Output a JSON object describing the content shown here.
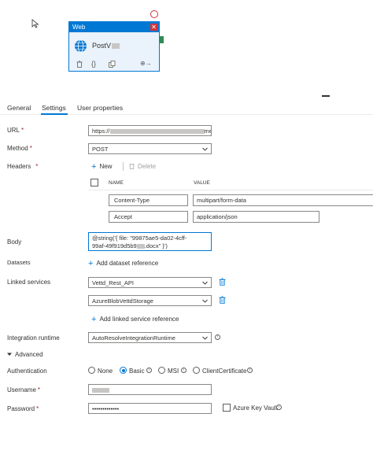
{
  "canvas": {
    "activity": {
      "type_label": "Web",
      "name": "PostV",
      "close_glyph": "✕",
      "tools": [
        "delete-icon",
        "code-icon",
        "copy-icon",
        "arrow-output-icon"
      ],
      "code_glyph": "{}",
      "out_glyph": "⊕→"
    }
  },
  "tabs": [
    {
      "label": "General"
    },
    {
      "label": "Settings",
      "active": true
    },
    {
      "label": "User properties"
    }
  ],
  "form": {
    "url": {
      "label": "URL",
      "value_prefix": "https://",
      "value_suffix": "me"
    },
    "method": {
      "label": "Method",
      "value": "POST"
    },
    "headers": {
      "label": "Headers",
      "new_label": "New",
      "delete_label": "Delete",
      "col_name": "NAME",
      "col_value": "VALUE",
      "rows": [
        {
          "name": "Content-Type",
          "value": "multipart/form-data"
        },
        {
          "name": "Accept",
          "value": "application/json"
        }
      ]
    },
    "body": {
      "label": "Body",
      "line1": "@string('{ file: \"99875ae5-da02-4cff-",
      "line2_a": "99af-49f919d5b9",
      "line2_b": ".docx\" }')"
    },
    "datasets": {
      "label": "Datasets",
      "add_label": "Add dataset reference"
    },
    "linked_services": {
      "label": "Linked services",
      "items": [
        "Vettd_Rest_API",
        "AzureBlobVettdStorage"
      ],
      "add_label": "Add linked service reference"
    },
    "integration_runtime": {
      "label": "Integration runtime",
      "value": "AutoResolveIntegrationRuntime"
    },
    "advanced": {
      "label": "Advanced"
    },
    "authentication": {
      "label": "Authentication",
      "options": [
        "None",
        "Basic",
        "MSI",
        "ClientCertificate"
      ],
      "selected": "Basic"
    },
    "username": {
      "label": "Username"
    },
    "password": {
      "label": "Password",
      "value": "•••••••••••••",
      "key_vault_label": "Azure Key Vault"
    }
  },
  "colors": {
    "accent": "#0078d4",
    "required": "#a4262c",
    "danger": "#d13438"
  }
}
